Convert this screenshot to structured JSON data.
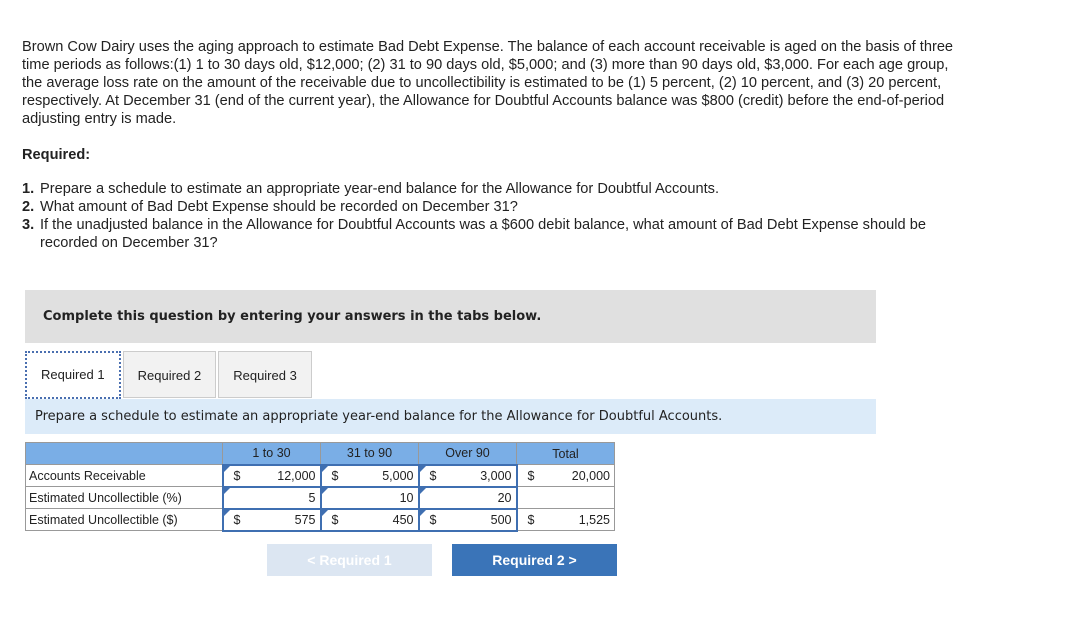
{
  "intro": "Brown Cow Dairy uses the aging approach to estimate Bad Debt Expense. The balance of each account receivable is aged on the basis of three time periods as follows:(1) 1 to 30 days old, $12,000; (2) 31 to 90 days old, $5,000; and (3) more than 90 days old, $3,000. For each age group, the average loss rate on the amount of the receivable due to uncollectibility is estimated to be (1) 5 percent, (2) 10 percent, and (3) 20 percent, respectively. At December 31 (end of the current year), the Allowance for Doubtful Accounts balance was $800 (credit) before the end-of-period adjusting entry is made.",
  "required_heading": "Required:",
  "requirements": [
    {
      "num": "1.",
      "text": "Prepare a schedule to estimate an appropriate year-end balance for the Allowance for Doubtful Accounts."
    },
    {
      "num": "2.",
      "text": "What amount of Bad Debt Expense should be recorded on December 31?"
    },
    {
      "num": "3.",
      "text": "If the unadjusted balance in the Allowance for Doubtful Accounts was a $600 debit balance, what amount of Bad Debt Expense should be recorded on December 31?"
    }
  ],
  "banner": "Complete this question by entering your answers in the tabs below.",
  "tabs": [
    "Required 1",
    "Required 2",
    "Required 3"
  ],
  "instruction": "Prepare a schedule to estimate an appropriate year-end balance for the Allowance for Doubtful Accounts.",
  "table": {
    "headers": [
      "",
      "1 to 30",
      "31 to 90",
      "Over 90",
      "Total"
    ],
    "rows": [
      {
        "label": "Accounts Receivable",
        "cells": [
          {
            "cur": "$",
            "val": "12,000"
          },
          {
            "cur": "$",
            "val": "5,000"
          },
          {
            "cur": "$",
            "val": "3,000"
          }
        ],
        "total": {
          "cur": "$",
          "val": "20,000"
        }
      },
      {
        "label": "Estimated Uncollectible (%)",
        "cells": [
          {
            "cur": "",
            "val": "5"
          },
          {
            "cur": "",
            "val": "10"
          },
          {
            "cur": "",
            "val": "20"
          }
        ],
        "total": {
          "cur": "",
          "val": ""
        }
      },
      {
        "label": "Estimated Uncollectible ($)",
        "cells": [
          {
            "cur": "$",
            "val": "575"
          },
          {
            "cur": "$",
            "val": "450"
          },
          {
            "cur": "$",
            "val": "500"
          }
        ],
        "total": {
          "cur": "$",
          "val": "1,525"
        }
      }
    ]
  },
  "nav": {
    "prev": "< Required 1",
    "next": "Required 2 >"
  }
}
